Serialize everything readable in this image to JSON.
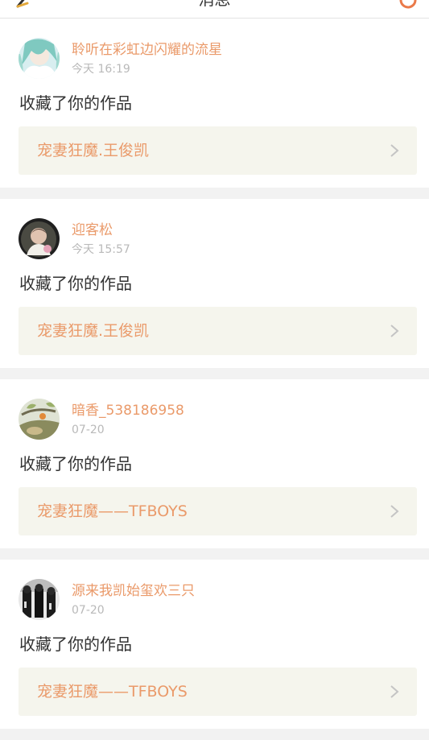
{
  "header": {
    "title": "消息",
    "back_icon": "back-arrow-icon",
    "right_icon": "notification-icon"
  },
  "colors": {
    "accent": "#ea9a6a",
    "time": "#b9b9b9",
    "text": "#333333",
    "work_bg": "#f5f5ed",
    "page_bg": "#f2f2f2"
  },
  "feed": [
    {
      "username": "聆听在彩虹边闪耀的流星",
      "time": "今天 16:19",
      "action": "收藏了你的作品",
      "work_title": "宠妻狂魔.王俊凯"
    },
    {
      "username": "迎客松",
      "time": "今天 15:57",
      "action": "收藏了你的作品",
      "work_title": "宠妻狂魔.王俊凯"
    },
    {
      "username": "暗香_538186958",
      "time": "07-20",
      "action": "收藏了你的作品",
      "work_title": "宠妻狂魔——TFBOYS"
    },
    {
      "username": "源来我凯始玺欢三只",
      "time": "07-20",
      "action": "收藏了你的作品",
      "work_title": "宠妻狂魔——TFBOYS"
    }
  ]
}
